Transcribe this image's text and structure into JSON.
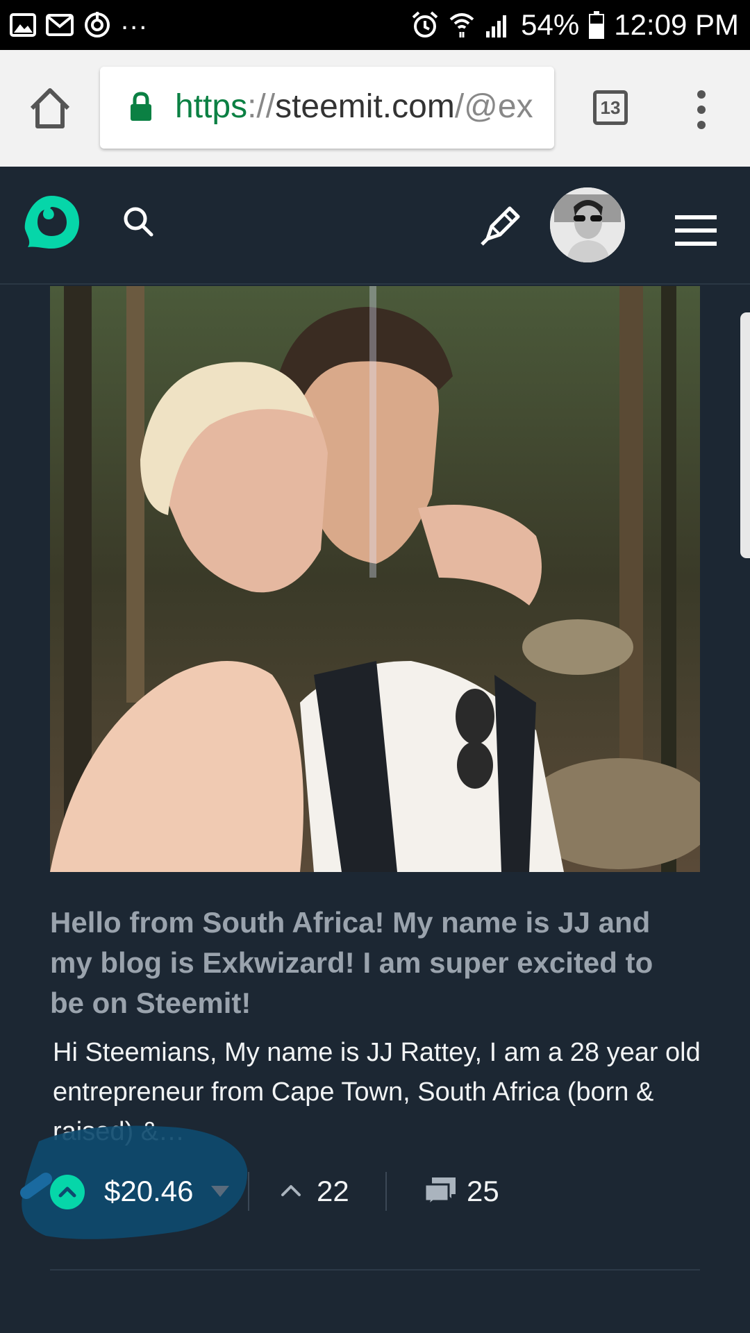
{
  "status_bar": {
    "overflow": "...",
    "battery": "54%",
    "time": "12:09 PM",
    "icons": [
      "gallery-icon",
      "mail-icon",
      "sync-icon",
      "alarm-icon",
      "wifi-icon",
      "signal-icon",
      "battery-icon"
    ]
  },
  "browser": {
    "url_scheme": "https",
    "url_sep": "://",
    "url_host": "steemit.com",
    "url_path": "/@ex",
    "tab_count": "13",
    "icons": [
      "home-icon",
      "lock-icon",
      "more-vert-icon"
    ]
  },
  "header": {
    "icons": [
      "steemit-logo",
      "search-icon",
      "pencil-icon",
      "hamburger-menu-icon"
    ],
    "brand_color": "#06d6a9"
  },
  "post": {
    "title": "Hello from South Africa! My name is JJ and my blog is Exkwizard! I am super excited to be on Steemit!",
    "excerpt": "Hi Steemians, My name is JJ Rattey, I am a 28 year old entrepreneur from Cape Town, South Africa (born & raised) &…",
    "payout": "$20.46",
    "votes": "22",
    "comments": "25"
  },
  "colors": {
    "background": "#1c2733",
    "accent": "#06d6a9",
    "title": "#9aa3ad",
    "text": "#f2f4f5"
  }
}
